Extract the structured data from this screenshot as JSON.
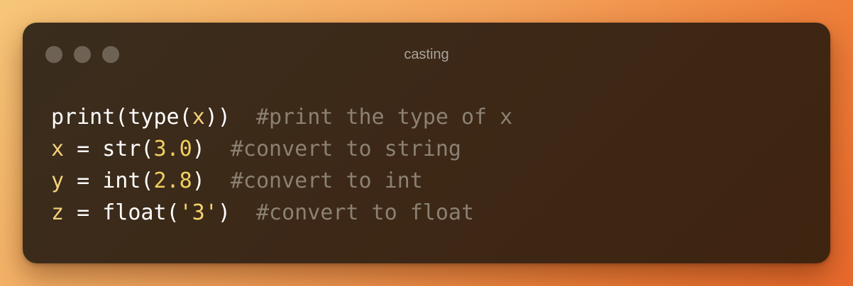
{
  "window": {
    "title": "casting"
  },
  "code": {
    "lines": [
      {
        "tokens": [
          {
            "text": "print(type(",
            "kind": "fn"
          },
          {
            "text": "x",
            "kind": "var"
          },
          {
            "text": "))",
            "kind": "fn"
          },
          {
            "text": "  ",
            "kind": "op"
          },
          {
            "text": "#print the type of x",
            "kind": "cm"
          }
        ]
      },
      {
        "tokens": [
          {
            "text": "x",
            "kind": "var"
          },
          {
            "text": " = ",
            "kind": "op"
          },
          {
            "text": "str(",
            "kind": "fn"
          },
          {
            "text": "3.0",
            "kind": "num"
          },
          {
            "text": ")",
            "kind": "fn"
          },
          {
            "text": "  ",
            "kind": "op"
          },
          {
            "text": "#convert to string",
            "kind": "cm"
          }
        ]
      },
      {
        "tokens": [
          {
            "text": "y",
            "kind": "var"
          },
          {
            "text": " = ",
            "kind": "op"
          },
          {
            "text": "int(",
            "kind": "fn"
          },
          {
            "text": "2.8",
            "kind": "num"
          },
          {
            "text": ")",
            "kind": "fn"
          },
          {
            "text": "  ",
            "kind": "op"
          },
          {
            "text": "#convert to int",
            "kind": "cm"
          }
        ]
      },
      {
        "tokens": [
          {
            "text": "z",
            "kind": "var"
          },
          {
            "text": " = ",
            "kind": "op"
          },
          {
            "text": "float(",
            "kind": "fn"
          },
          {
            "text": "'3'",
            "kind": "str"
          },
          {
            "text": ")",
            "kind": "fn"
          },
          {
            "text": "  ",
            "kind": "op"
          },
          {
            "text": "#convert to float",
            "kind": "cm"
          }
        ]
      }
    ]
  }
}
